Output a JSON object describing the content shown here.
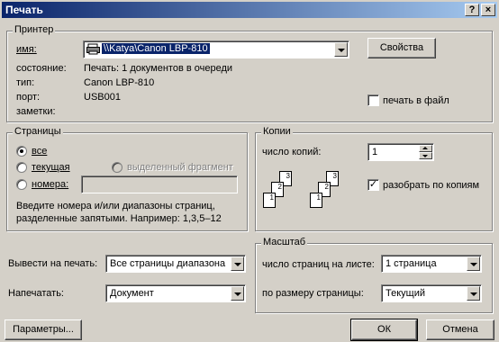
{
  "window": {
    "title": "Печать",
    "help_label": "?",
    "close_label": "×"
  },
  "printer": {
    "legend": "Принтер",
    "name_label": "имя:",
    "name_value": "\\\\Katya\\Canon LBP-810",
    "properties_button": "Свойства",
    "status_label": "состояние:",
    "status_value": "Печать: 1 документов в очереди",
    "type_label": "тип:",
    "type_value": "Canon LBP-810",
    "port_label": "порт:",
    "port_value": "USB001",
    "notes_label": "заметки:",
    "print_to_file_label": "печать в файл",
    "print_to_file_checked": false
  },
  "pages": {
    "legend": "Страницы",
    "all_label": "все",
    "current_label": "текущая",
    "selection_label": "выделенный фрагмент",
    "numbers_label": "номера:",
    "numbers_value": "",
    "selected": "all",
    "hint": "Введите номера и/или диапазоны страниц,\nразделенные запятыми. Например: 1,3,5–12",
    "hint_line1": "Введите номера и/или диапазоны страниц,",
    "hint_line2": "разделенные запятыми. Например: 1,3,5–12"
  },
  "copies": {
    "legend": "Копии",
    "count_label": "число копий:",
    "count_value": "1",
    "collate_label": "разобрать по копиям",
    "collate_checked": true,
    "page_labels": [
      "1",
      "2",
      "3"
    ]
  },
  "print_what": {
    "label": "Вывести на печать:",
    "value": "Все страницы диапазона"
  },
  "print_item": {
    "label": "Напечатать:",
    "value": "Документ"
  },
  "zoom": {
    "legend": "Масштаб",
    "pages_per_sheet_label": "число страниц на листе:",
    "pages_per_sheet_value": "1 страница",
    "scale_label": "по размеру страницы:",
    "scale_value": "Текущий"
  },
  "buttons": {
    "options": "Параметры...",
    "ok": "ОК",
    "cancel": "Отмена"
  }
}
